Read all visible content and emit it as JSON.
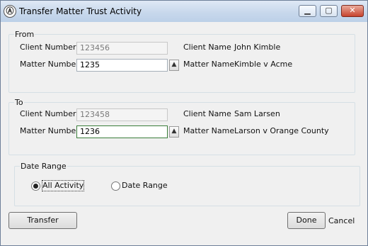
{
  "window": {
    "title": "Transfer Matter Trust Activity",
    "icon_name": "app-icon",
    "icon_glyph": "Ⓐ",
    "min_glyph": "▁",
    "max_glyph": "▢",
    "close_glyph": "✕"
  },
  "from": {
    "legend": "From",
    "client_number_label": "Client Number",
    "client_number_value": "123456",
    "client_name_label": "Client Name",
    "client_name_value": "John Kimble",
    "matter_number_label": "Matter Number",
    "matter_number_value": "1235",
    "matter_name_label": "Matter Name",
    "matter_name_value": "Kimble v Acme",
    "spin_glyph": "▲"
  },
  "to": {
    "legend": "To",
    "client_number_label": "Client Number",
    "client_number_value": "123458",
    "client_name_label": "Client Name",
    "client_name_value": "Sam Larsen",
    "matter_number_label": "Matter Number",
    "matter_number_value": "1236",
    "matter_name_label": "Matter Name",
    "matter_name_value": "Larson v Orange County",
    "spin_glyph": "▲"
  },
  "date_range": {
    "legend": "Date Range",
    "options": [
      {
        "label": "All Activity",
        "selected": true
      },
      {
        "label": "Date Range",
        "selected": false
      }
    ]
  },
  "buttons": {
    "transfer": "Transfer",
    "done": "Done",
    "cancel": "Cancel"
  },
  "colors": {
    "focus_border": "#3a7d3a",
    "close_button": "#c7432e"
  }
}
